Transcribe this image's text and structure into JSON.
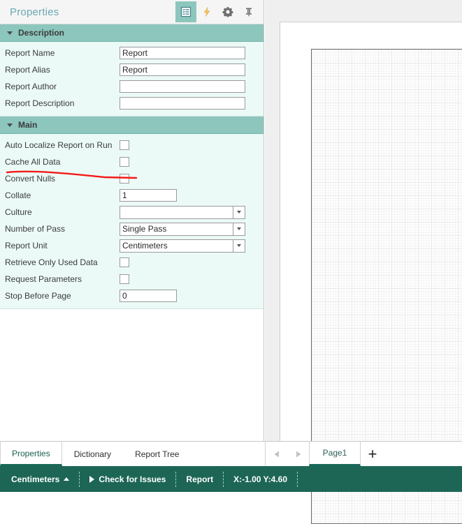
{
  "panel": {
    "title": "Properties",
    "icons": [
      {
        "name": "properties-grid-icon",
        "active": true
      },
      {
        "name": "events-lightning-icon",
        "active": false
      },
      {
        "name": "settings-gear-icon",
        "active": false
      },
      {
        "name": "pin-icon",
        "active": false
      }
    ]
  },
  "sections": [
    {
      "name": "description",
      "title": "Description",
      "expanded": true,
      "rows": [
        {
          "label": "Report Name",
          "type": "text",
          "value": "Report",
          "placeholder": ""
        },
        {
          "label": "Report Alias",
          "type": "text",
          "value": "Report",
          "placeholder": ""
        },
        {
          "label": "Report Author",
          "type": "text",
          "value": "",
          "placeholder": ""
        },
        {
          "label": "Report Description",
          "type": "text",
          "value": "",
          "placeholder": ""
        }
      ]
    },
    {
      "name": "main",
      "title": "Main",
      "expanded": true,
      "rows": [
        {
          "label": "Auto Localize Report on Run",
          "type": "checkbox",
          "checked": false
        },
        {
          "label": "Cache All Data",
          "type": "checkbox",
          "checked": false
        },
        {
          "label": "Convert Nulls",
          "type": "checkbox",
          "checked": false
        },
        {
          "label": "Collate",
          "type": "text-small",
          "value": "1",
          "placeholder": ""
        },
        {
          "label": "Culture",
          "type": "combo",
          "value": "",
          "placeholder": ""
        },
        {
          "label": "Number of Pass",
          "type": "combo",
          "value": "Single Pass",
          "placeholder": ""
        },
        {
          "label": "Report Unit",
          "type": "combo",
          "value": "Centimeters",
          "placeholder": ""
        },
        {
          "label": "Retrieve Only Used Data",
          "type": "checkbox",
          "checked": false
        },
        {
          "label": "Request Parameters",
          "type": "checkbox",
          "checked": false
        },
        {
          "label": "Stop Before Page",
          "type": "text-small",
          "value": "0",
          "placeholder": ""
        }
      ]
    }
  ],
  "annotation": {
    "name": "red-underline-annotation",
    "color": "#f41a1a",
    "target_label": "Cache All Data"
  },
  "bottom_tabs": [
    {
      "label": "Properties",
      "active": true
    },
    {
      "label": "Dictionary",
      "active": false
    },
    {
      "label": "Report Tree",
      "active": false
    }
  ],
  "page_tabs": {
    "prev_icon": "chevron-left-icon",
    "next_icon": "chevron-right-icon",
    "tabs": [
      {
        "label": "Page1",
        "active": true
      }
    ],
    "add_label": "+"
  },
  "statusbar": {
    "unit": "Centimeters",
    "check_issues": "Check for Issues",
    "report": "Report",
    "coords": "X:-1.00 Y:4.60"
  },
  "colors": {
    "accent_teal": "#8cc6bd",
    "section_body": "#ebfaf7",
    "statusbar": "#1d6656",
    "title_blue": "#6aa8b4",
    "annotation_red": "#f41a1a"
  }
}
